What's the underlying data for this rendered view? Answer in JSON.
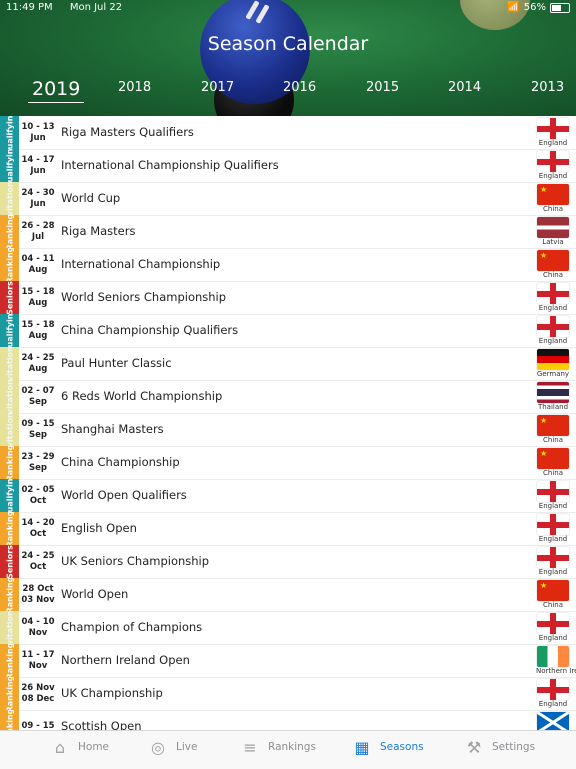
{
  "status_bar": {
    "time": "11:49 PM",
    "date": "Mon Jul 22",
    "battery": "56%"
  },
  "header": {
    "title": "Season Calendar",
    "years": [
      "2019",
      "2018",
      "2017",
      "2016",
      "2015",
      "2014",
      "2013"
    ],
    "selected_year": "2019"
  },
  "colors": {
    "qualifying": "#1a9aa0",
    "ranking": "#f3a42a",
    "invitational": "#e6e29a",
    "seniors": "#cf2a2a",
    "tab_active": "#1e7bd8"
  },
  "events": [
    {
      "dates": [
        "10 - 13",
        "Jun"
      ],
      "name": "Riga Masters Qualifiers",
      "type": "Qualifying",
      "country": "England",
      "flag": "england-flag-icon"
    },
    {
      "dates": [
        "14 - 17",
        "Jun"
      ],
      "name": "International Championship Qualifiers",
      "type": "Qualifying",
      "country": "England",
      "flag": "england-flag-icon"
    },
    {
      "dates": [
        "24 - 30",
        "Jun"
      ],
      "name": "World Cup",
      "type": "Invitational",
      "country": "China",
      "flag": "china-flag-icon"
    },
    {
      "dates": [
        "26 - 28",
        "Jul"
      ],
      "name": "Riga Masters",
      "type": "Ranking",
      "country": "Latvia",
      "flag": "latvia-flag-icon"
    },
    {
      "dates": [
        "04 - 11",
        "Aug"
      ],
      "name": "International Championship",
      "type": "Ranking",
      "country": "China",
      "flag": "china-flag-icon"
    },
    {
      "dates": [
        "15 - 18",
        "Aug"
      ],
      "name": "World Seniors Championship",
      "type": "Seniors",
      "country": "England",
      "flag": "england-flag-icon"
    },
    {
      "dates": [
        "15 - 18",
        "Aug"
      ],
      "name": "China Championship Qualifiers",
      "type": "Qualifying",
      "country": "England",
      "flag": "england-flag-icon"
    },
    {
      "dates": [
        "24 - 25",
        "Aug"
      ],
      "name": "Paul Hunter Classic",
      "type": "Invitational",
      "country": "Germany",
      "flag": "germany-flag-icon"
    },
    {
      "dates": [
        "02 - 07",
        "Sep"
      ],
      "name": "6 Reds World Championship",
      "type": "Invitational",
      "country": "Thailand",
      "flag": "thailand-flag-icon"
    },
    {
      "dates": [
        "09 - 15",
        "Sep"
      ],
      "name": "Shanghai Masters",
      "type": "Invitational",
      "country": "China",
      "flag": "china-flag-icon"
    },
    {
      "dates": [
        "23 - 29",
        "Sep"
      ],
      "name": "China Championship",
      "type": "Ranking",
      "country": "China",
      "flag": "china-flag-icon"
    },
    {
      "dates": [
        "02 - 05",
        "Oct"
      ],
      "name": "World Open Qualifiers",
      "type": "Qualifying",
      "country": "England",
      "flag": "england-flag-icon"
    },
    {
      "dates": [
        "14 - 20",
        "Oct"
      ],
      "name": "English Open",
      "type": "Ranking",
      "country": "England",
      "flag": "england-flag-icon"
    },
    {
      "dates": [
        "24 - 25",
        "Oct"
      ],
      "name": "UK Seniors Championship",
      "type": "Seniors",
      "country": "England",
      "flag": "england-flag-icon"
    },
    {
      "dates": [
        "28 Oct",
        "03 Nov"
      ],
      "name": "World Open",
      "type": "Ranking",
      "country": "China",
      "flag": "china-flag-icon"
    },
    {
      "dates": [
        "04 - 10",
        "Nov"
      ],
      "name": "Champion of Champions",
      "type": "Invitational",
      "country": "England",
      "flag": "england-flag-icon"
    },
    {
      "dates": [
        "11 - 17",
        "Nov"
      ],
      "name": "Northern Ireland Open",
      "type": "Ranking",
      "country": "Northern Ireland",
      "flag": "ireland-flag-icon"
    },
    {
      "dates": [
        "26 Nov",
        "08 Dec"
      ],
      "name": "UK Championship",
      "type": "Ranking",
      "country": "England",
      "flag": "england-flag-icon"
    },
    {
      "dates": [
        "09 - 15",
        ""
      ],
      "name": "Scottish Open",
      "type": "Ranking",
      "country": "",
      "flag": "scotland-flag-icon"
    }
  ],
  "tabs": [
    {
      "label": "Home",
      "icon": "home-icon"
    },
    {
      "label": "Live",
      "icon": "live-icon"
    },
    {
      "label": "Rankings",
      "icon": "rankings-icon"
    },
    {
      "label": "Seasons",
      "icon": "seasons-icon",
      "active": true
    },
    {
      "label": "Settings",
      "icon": "settings-icon"
    }
  ]
}
